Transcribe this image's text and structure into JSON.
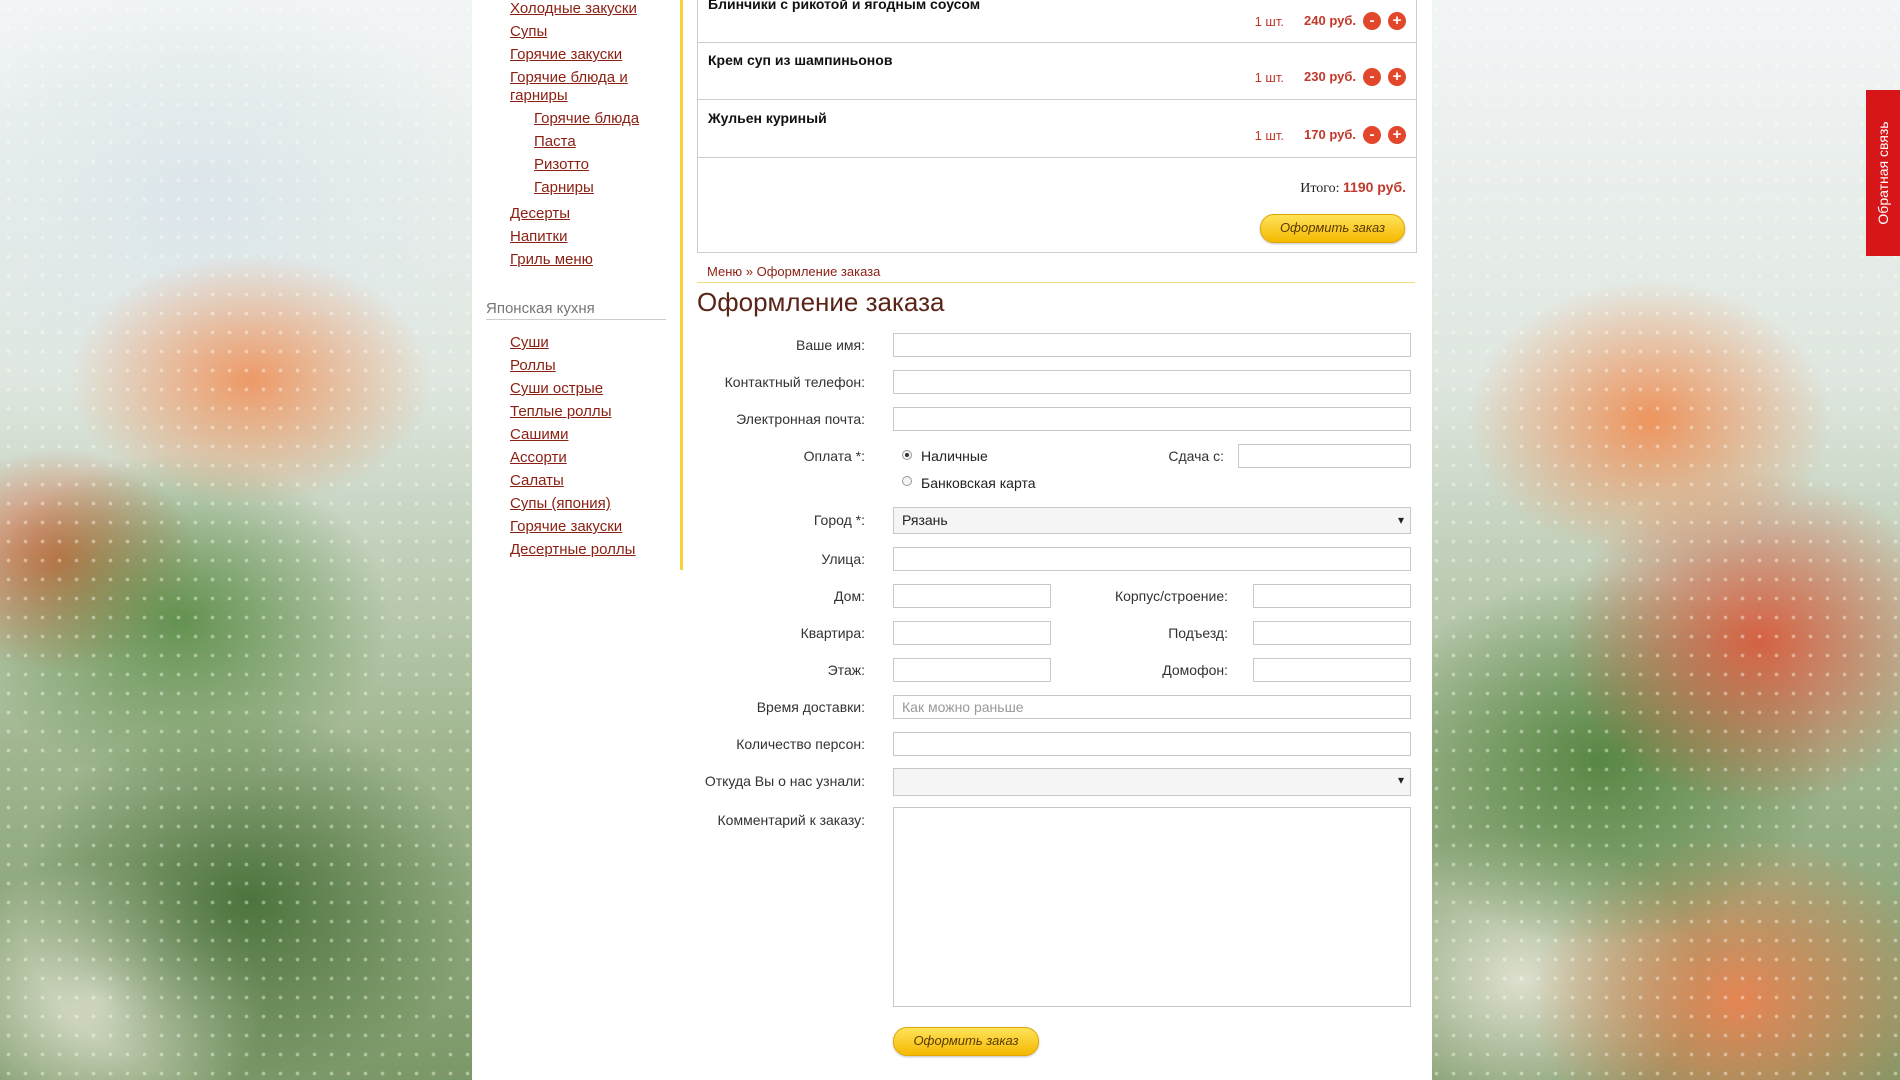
{
  "sidebar": {
    "menu_items": [
      "Холодные закуски",
      "Супы",
      "Горячие закуски",
      "Горячие блюда и",
      "гарниры",
      "Горячие блюда",
      "Паста",
      "Ризотто",
      "Гарниры",
      "Десерты",
      "Напитки",
      "Гриль меню"
    ],
    "japanese_title": "Японская кухня",
    "japanese_items": [
      "Суши",
      "Роллы",
      "Суши острые",
      "Теплые роллы",
      "Сашими",
      "Ассорти",
      "Салаты",
      "Супы (япония)",
      "Горячие закуски",
      "Десертные роллы"
    ]
  },
  "cart": {
    "items": [
      {
        "name": "Блинчики с рикотой и ягодным соусом",
        "qty": "1 шт.",
        "price": "240 руб."
      },
      {
        "name": "Крем суп из шампиньонов",
        "qty": "1 шт.",
        "price": "230 руб."
      },
      {
        "name": "Жульен куриный",
        "qty": "1 шт.",
        "price": "170 руб."
      }
    ],
    "minus_label": "-",
    "plus_label": "+",
    "total_label": "Итого:",
    "total_value": "1190 руб.",
    "order_button": "Оформить заказ"
  },
  "breadcrumb": {
    "menu": "Меню",
    "separator": "»",
    "current": "Оформление заказа"
  },
  "page_title": "Оформление заказа",
  "form": {
    "name_label": "Ваше имя:",
    "phone_label": "Контактный телефон:",
    "email_label": "Электронная почта:",
    "payment_label": "Оплата *:",
    "payment_cash": "Наличные",
    "payment_card": "Банковская карта",
    "change_label": "Сдача с:",
    "city_label": "Город *:",
    "city_value": "Рязань",
    "street_label": "Улица:",
    "house_label": "Дом:",
    "building_label": "Корпус/строение:",
    "apartment_label": "Квартира:",
    "entrance_label": "Подъезд:",
    "floor_label": "Этаж:",
    "intercom_label": "Домофон:",
    "time_label": "Время доставки:",
    "time_placeholder": "Как можно раньше",
    "persons_label": "Количество персон:",
    "source_label": "Откуда Вы о нас узнали:",
    "comment_label": "Комментарий к заказу:",
    "submit_button": "Оформить заказ"
  },
  "feedback_tab": "Обратная связь"
}
